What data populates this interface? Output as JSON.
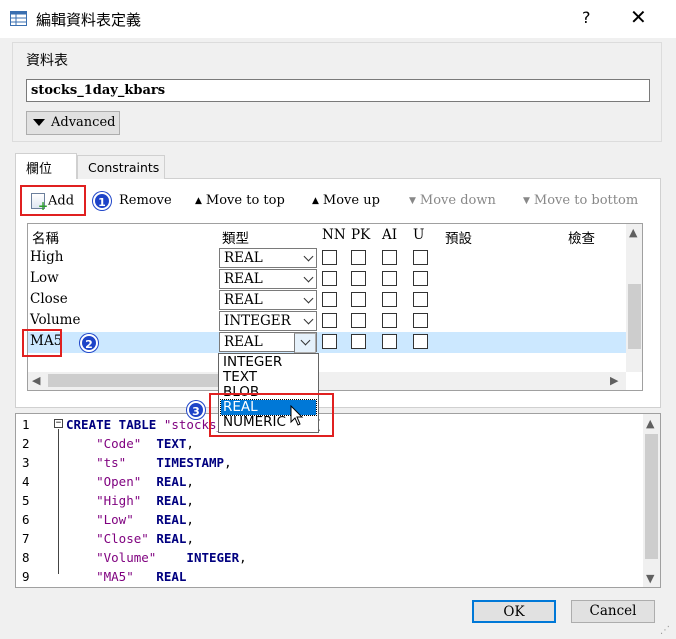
{
  "window": {
    "title": "編輯資料表定義",
    "help": "?",
    "close": "✕"
  },
  "table_section": {
    "label": "資料表",
    "table_name": "stocks_1day_kbars",
    "advanced_label": "Advanced"
  },
  "tabs": [
    {
      "label": "欄位",
      "active": true
    },
    {
      "label": "Constraints",
      "active": false
    }
  ],
  "toolbar": {
    "add": "Add",
    "remove": "Remove",
    "move_top": "Move to top",
    "move_up": "Move up",
    "move_down": "Move down",
    "move_bottom": "Move to bottom"
  },
  "grid": {
    "headers": {
      "name": "名稱",
      "type": "類型",
      "nn": "NN",
      "pk": "PK",
      "ai": "AI",
      "u": "U",
      "default": "預設",
      "check": "檢查"
    },
    "rows": [
      {
        "name": "High",
        "type": "REAL"
      },
      {
        "name": "Low",
        "type": "REAL"
      },
      {
        "name": "Close",
        "type": "REAL"
      },
      {
        "name": "Volume",
        "type": "INTEGER"
      },
      {
        "name": "MA5",
        "type": "REAL",
        "selected": true
      }
    ]
  },
  "type_dropdown": {
    "options": [
      "INTEGER",
      "TEXT",
      "BLOB",
      "REAL",
      "NUMERIC"
    ],
    "highlighted": "REAL"
  },
  "badges": [
    "1",
    "2",
    "3"
  ],
  "sql": {
    "line_numbers": [
      "1",
      "2",
      "3",
      "4",
      "5",
      "6",
      "7",
      "8",
      "9"
    ],
    "lines": [
      {
        "a": "CREATE TABLE ",
        "b": "\"stocks_1day_kbars\"",
        "c": " ("
      },
      {
        "a": "    \"Code\"",
        "b": "  TEXT",
        "c": ","
      },
      {
        "a": "    \"ts\"",
        "b": "    TIMESTAMP",
        "c": ","
      },
      {
        "a": "    \"Open\"",
        "b": "  REAL",
        "c": ","
      },
      {
        "a": "    \"High\"",
        "b": "  REAL",
        "c": ","
      },
      {
        "a": "    \"Low\"",
        "b": "   REAL",
        "c": ","
      },
      {
        "a": "    \"Close\"",
        "b": " REAL",
        "c": ","
      },
      {
        "a": "    \"Volume\"",
        "b": "    INTEGER",
        "c": ","
      },
      {
        "a": "    \"MA5\"",
        "b": "   REAL",
        "c": ""
      }
    ]
  },
  "buttons": {
    "ok": "OK",
    "cancel": "Cancel"
  },
  "colors": {
    "accent": "#0078d7",
    "callout": "#e02020",
    "badge": "#1e44c8",
    "selected_row": "#cce8ff"
  }
}
